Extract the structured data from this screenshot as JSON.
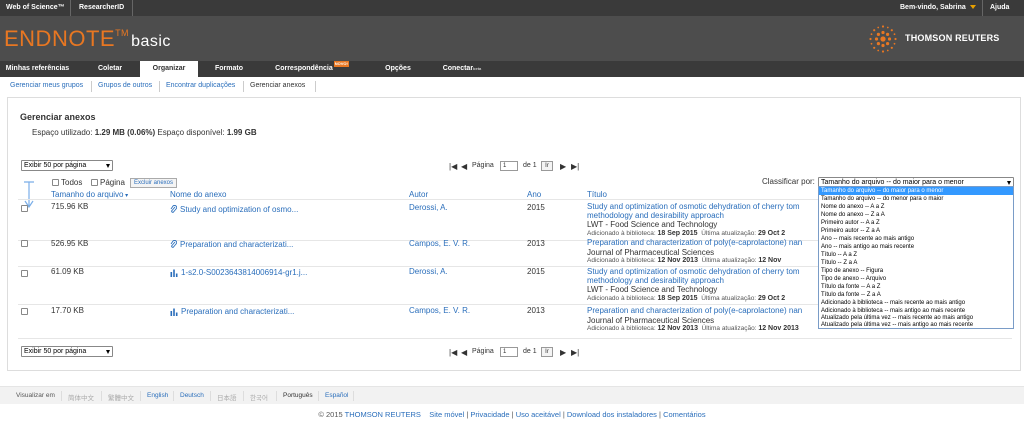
{
  "topbar": {
    "web_of_science": "Web of Science™",
    "researcher_id": "ResearcherID",
    "welcome": "Bem-vindo, Sabrina",
    "help": "Ajuda"
  },
  "brand": {
    "name": "ENDNOTE",
    "tm": "TM",
    "edition": "basic",
    "company": "THOMSON REUTERS"
  },
  "main_nav": {
    "tabs": [
      "Minhas referências",
      "Coletar",
      "Organizar",
      "Formato",
      "Correspondência",
      "Opções",
      "Conectar"
    ],
    "new_badge": "NOVO!",
    "beta": "beta"
  },
  "sub_nav": [
    "Gerenciar meus grupos",
    "Grupos de outros",
    "Encontrar duplicações",
    "Gerenciar anexos"
  ],
  "page": {
    "title": "Gerenciar anexos",
    "used_label": "Espaço utilizado:",
    "used_value": "1.29 MB (0.06%)",
    "available_label": "Espaço disponível:",
    "available_value": "1.99 GB"
  },
  "toolbar": {
    "per_page": "Exibir 50 por página",
    "page_label": "Página",
    "page_value": "1",
    "of_label": "de 1",
    "go": "Ir",
    "sort_label": "Classificar por:",
    "sort_value": "Tamanho do arquivo -- do maior para o menor",
    "all_label": "Todos",
    "page_check_label": "Página",
    "delete_button": "Excluir anexos"
  },
  "columns": {
    "size": "Tamanho do arquivo",
    "attachment": "Nome do anexo",
    "author": "Autor",
    "year": "Ano",
    "title": "Título"
  },
  "rows": [
    {
      "size": "715.96 KB",
      "file": "Study and optimization of osmo...",
      "file_icon": "paperclip-icon",
      "author": "Derossi, A.",
      "year": "2015",
      "title_l1": "Study and optimization of osmotic dehydration of cherry tom",
      "title_l2": "methodology and desirability approach",
      "journal": "LWT - Food Science and Technology",
      "added_label": "Adicionado à biblioteca:",
      "added": "18 Sep 2015",
      "updated_label": "Última atualização:",
      "updated": "29 Oct 2"
    },
    {
      "size": "526.95 KB",
      "file": "Preparation and characterizati...",
      "file_icon": "paperclip-icon",
      "author": "Campos, E. V. R.",
      "year": "2013",
      "title_l1": "Preparation and characterization of poly(e-caprolactone) nan",
      "title_l2": "",
      "journal": "Journal of Pharmaceutical Sciences",
      "added_label": "Adicionado à biblioteca:",
      "added": "12 Nov 2013",
      "updated_label": "Última atualização:",
      "updated": "12 Nov"
    },
    {
      "size": "61.09 KB",
      "file": "1-s2.0-S0023643814006914-gr1.j...",
      "file_icon": "figure-icon",
      "author": "Derossi, A.",
      "year": "2015",
      "title_l1": "Study and optimization of osmotic dehydration of cherry tom",
      "title_l2": "methodology and desirability approach",
      "journal": "LWT - Food Science and Technology",
      "added_label": "Adicionado à biblioteca:",
      "added": "18 Sep 2015",
      "updated_label": "Última atualização:",
      "updated": "29 Oct 2"
    },
    {
      "size": "17.70 KB",
      "file": "Preparation and characterizati...",
      "file_icon": "figure-icon",
      "author": "Campos, E. V. R.",
      "year": "2013",
      "title_l1": "Preparation and characterization of poly(e-caprolactone) nan",
      "title_l2": "",
      "journal": "Journal of Pharmaceutical Sciences",
      "added_label": "Adicionado à biblioteca:",
      "added": "12 Nov 2013",
      "updated_label": "Última atualização:",
      "updated": "12 Nov 2013"
    }
  ],
  "sort_options": [
    "Tamanho do arquivo -- do maior para o menor",
    "Tamanho do arquivo -- do menor para o maior",
    "Nome do anexo -- A a Z",
    "Nome do anexo -- Z a A",
    "Primeiro autor -- A a Z",
    "Primeiro autor -- Z a A",
    "Ano -- mais recente ao mais antigo",
    "Ano -- mais antigo ao mais recente",
    "Título -- A a Z",
    "Título -- Z a A",
    "Tipo de anexo -- Figura",
    "Tipo de anexo -- Arquivo",
    "Título da fonte -- A a Z",
    "Título da fonte -- Z a A",
    "Adicionado à biblioteca -- mais recente ao mais antigo",
    "Adicionado à biblioteca -- mais antigo ao mais recente",
    "Atualizado pela última vez -- mais recente ao mais antigo",
    "Atualizado pela última vez -- mais antigo ao mais recente"
  ],
  "languages": {
    "label": "Visualizar em",
    "items": [
      "简体中文",
      "繁體中文",
      "English",
      "Deutsch",
      "日本語",
      "한국어",
      "Português",
      "Español"
    ]
  },
  "footer": {
    "copyright": "© 2015",
    "company": "THOMSON REUTERS",
    "links": [
      "Site móvel",
      "Privacidade",
      "Uso aceitável",
      "Download dos instaladores",
      "Comentários"
    ]
  },
  "colors": {
    "brand_orange": "#e87722",
    "link_blue": "#2a6ebb",
    "header_grey": "#4d4d4d",
    "nav_dark": "#3a3a3a"
  }
}
